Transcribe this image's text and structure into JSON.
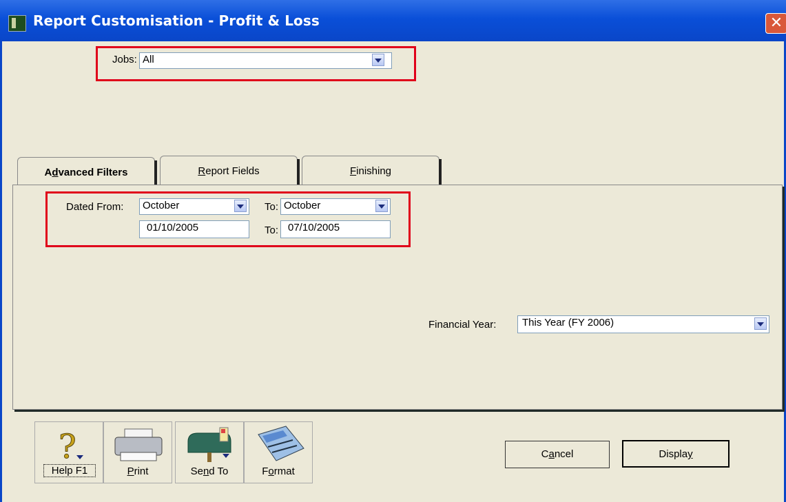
{
  "window": {
    "title": "Report Customisation - Profit & Loss",
    "close_glyph": "✕"
  },
  "jobs": {
    "label": "Jobs:",
    "value": "All"
  },
  "tabs": [
    {
      "label": "Advanced Filters",
      "accesskey": "d",
      "active": true
    },
    {
      "label": "Report Fields",
      "accesskey": "R",
      "active": false
    },
    {
      "label": "Finishing",
      "accesskey": "F",
      "active": false
    }
  ],
  "filters": {
    "dated_from_label": "Dated From:",
    "from_month": "October",
    "to_label": "To:",
    "to_month": "October",
    "from_date": "01/10/2005",
    "to_date_label": "To:",
    "to_date": "07/10/2005",
    "financial_year_label": "Financial Year:",
    "financial_year": "This Year (FY 2006)"
  },
  "toolbar": [
    {
      "label": "Help F1",
      "icon": "help-icon"
    },
    {
      "label": "Print",
      "icon": "printer-icon"
    },
    {
      "label": "Send To",
      "icon": "mailbox-icon"
    },
    {
      "label": "Format",
      "icon": "format-icon"
    }
  ],
  "buttons": {
    "cancel": "Cancel",
    "display": "Display"
  },
  "colors": {
    "titlebar": "#0a4fd8",
    "highlight": "#e0001a",
    "window_bg": "#ece9d8"
  }
}
